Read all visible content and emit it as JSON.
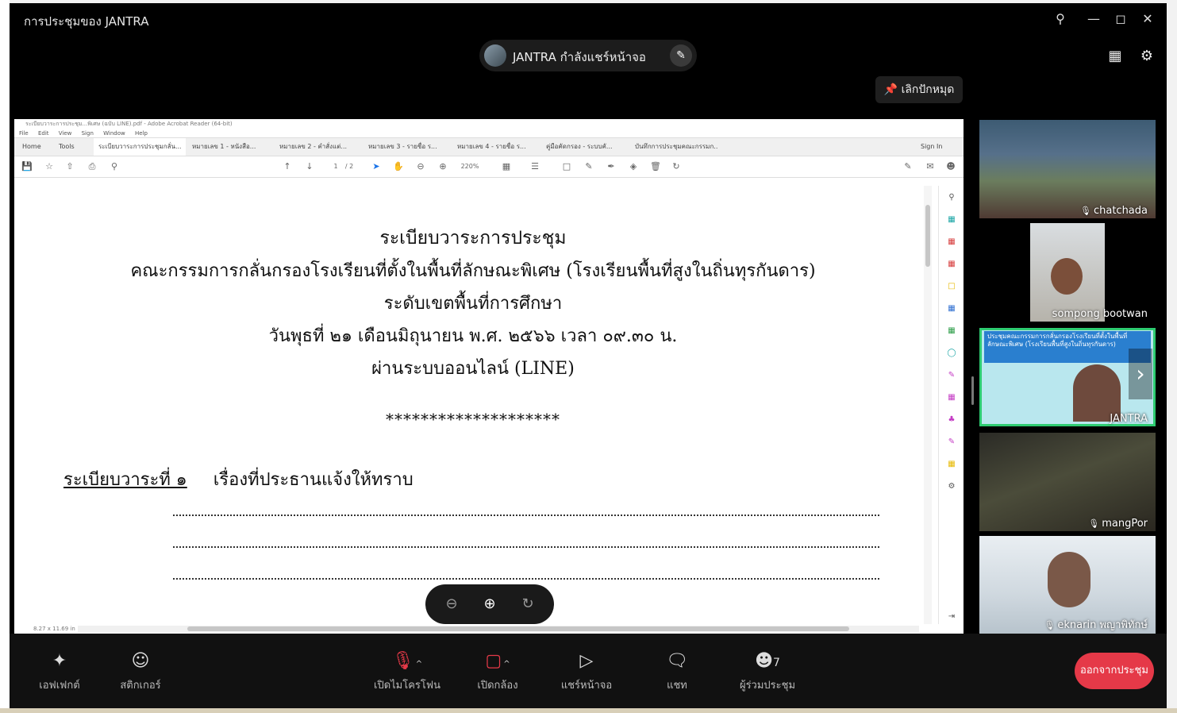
{
  "window": {
    "title": "การประชุมของ JANTRA",
    "controls": [
      "pin-icon",
      "minimize-icon",
      "maximize-icon",
      "close-icon"
    ]
  },
  "share_banner": {
    "text": "JANTRA กำลังแชร์หน้าจอ",
    "edit_icon": "pencil-icon"
  },
  "top_right": {
    "layout_icon": "layout-icon",
    "settings_icon": "gear-icon"
  },
  "unpin_button": {
    "label": "เลิกปักหมุด",
    "icon": "pin-icon"
  },
  "acrobat": {
    "title": "ระเบียบวาระการประชุม...พิเศษ (ฉบับ LINE).pdf - Adobe Acrobat Reader (64-bit)",
    "menu": [
      "File",
      "Edit",
      "View",
      "Sign",
      "Window",
      "Help"
    ],
    "tabs": [
      "Home",
      "Tools",
      "ระเบียบวาระการประชุมกลั่น...",
      "หมายเลข 1 - หนังสือ...",
      "หมายเลข 2 - คำสั่งแต่...",
      "หมายเลข 3 - รายชื่อ ร...",
      "หมายเลข 4 - รายชื่อ ร...",
      "คู่มือคัดกรอง - ระบบคั...",
      "บันทึกการประชุมคณะกรรมก..."
    ],
    "sign_in": "Sign In",
    "page_current": "1",
    "page_total": "/ 2",
    "zoom": "220%",
    "page_size": "8.27 x 11.69 in"
  },
  "document": {
    "heading_lines": [
      "ระเบียบวาระการประชุม",
      "คณะกรรมการกลั่นกรองโรงเรียนที่ตั้งในพื้นที่ลักษณะพิเศษ (โรงเรียนพื้นที่สูงในถิ่นทุรกันดาร)",
      "ระดับเขตพื้นที่การศึกษา",
      "วันพุธที่  ๒๑  เดือนมิถุนายน  พ.ศ. ๒๕๖๖  เวลา ๐๙.๓๐ น.",
      "ผ่านระบบออนไลน์ (LINE)"
    ],
    "separator": "********************",
    "agenda_label": "ระเบียบวาระที่ ๑",
    "agenda_title": "เรื่องที่ประธานแจ้งให้ทราบ"
  },
  "zoom_controls": [
    "zoom-out-icon",
    "zoom-in-icon",
    "rotate-icon"
  ],
  "participants": [
    {
      "name": "chatchada",
      "muted": true
    },
    {
      "name": "sompong bootwan",
      "muted": false
    },
    {
      "name": "JANTRA",
      "muted": false,
      "speaking": true,
      "slide_title": "ประชุมคณะกรรมการกลั่นกรองโรงเรียนที่ตั้งในพื้นที่ลักษณะพิเศษ (โรงเรียนพื้นที่สูงในถิ่นทุรกันดาร)"
    },
    {
      "name": "mangPor",
      "muted": true
    },
    {
      "name": "eknarin พญาพิทักษ์",
      "muted": true
    }
  ],
  "toolbar": {
    "effects": "เอฟเฟกต์",
    "stickers": "สติกเกอร์",
    "mic": "เปิดไมโครโฟน",
    "camera": "เปิดกล้อง",
    "share": "แชร์หน้าจอ",
    "chat": "แชท",
    "participants": "ผู้ร่วมประชุม",
    "participant_count": "7",
    "leave": "ออกจากประชุม"
  },
  "colors": {
    "leave": "#e53948",
    "speaking_outline": "#2ecc71",
    "background": "#000000"
  }
}
